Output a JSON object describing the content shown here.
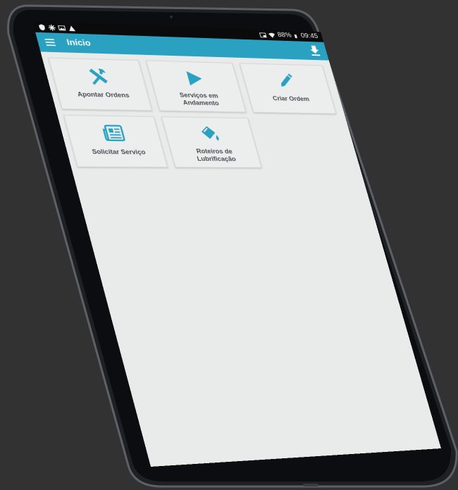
{
  "status_bar": {
    "battery": "88%",
    "time": "09:45"
  },
  "toolbar": {
    "title": "Início"
  },
  "tiles": [
    {
      "label_line1": "Apontar Ordens",
      "label_line2": "",
      "icon": "tools-icon"
    },
    {
      "label_line1": "Serviços em",
      "label_line2": "Andamento",
      "icon": "play-icon"
    },
    {
      "label_line1": "Criar Ordem",
      "label_line2": "",
      "icon": "pencil-icon"
    },
    {
      "label_line1": "Solicitar Serviço",
      "label_line2": "",
      "icon": "newspaper-icon"
    },
    {
      "label_line1": "Roteiros de",
      "label_line2": "Lubrificação",
      "icon": "paint-bucket-icon"
    }
  ],
  "colors": {
    "accent": "#2aa1c1",
    "background": "#e9eaea",
    "label": "#4a4e52"
  }
}
